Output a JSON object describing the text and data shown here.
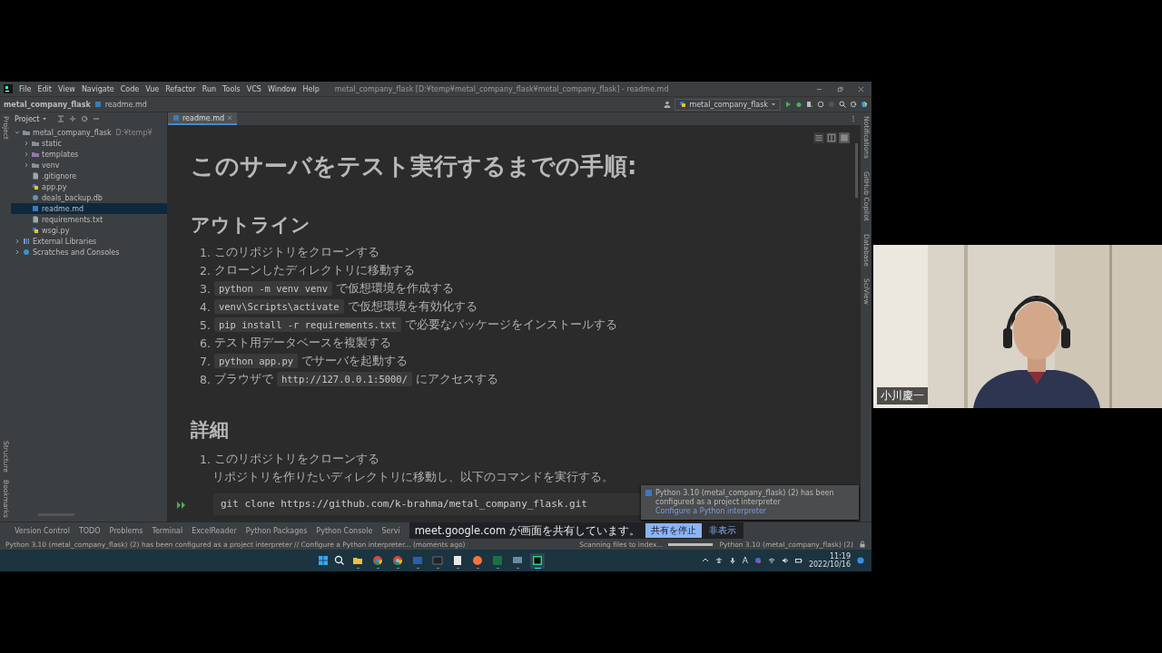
{
  "window": {
    "title": "metal_company_flask [D:¥temp¥metal_company_flask¥metal_company_flask] - readme.md"
  },
  "menu": [
    "File",
    "Edit",
    "View",
    "Navigate",
    "Code",
    "Vue",
    "Refactor",
    "Run",
    "Tools",
    "VCS",
    "Window",
    "Help"
  ],
  "breadcrumb": [
    "metal_company_flask",
    "readme.md"
  ],
  "run_config": "metal_company_flask",
  "left_stripe": [
    "Project",
    "Structure",
    "Bookmarks"
  ],
  "right_stripe": [
    "Notifications",
    "GitHub Copilot",
    "Database",
    "SciView"
  ],
  "project_tool": {
    "label": "Project"
  },
  "editor_tabs": [
    {
      "label": "readme.md",
      "selected": true
    }
  ],
  "tree": [
    {
      "label": "metal_company_flask",
      "hint": "D:¥temp¥",
      "kind": "folder",
      "expanded": true,
      "selected": false,
      "children": [
        {
          "label": "static",
          "kind": "folder",
          "expanded": false,
          "selected": false
        },
        {
          "label": "templates",
          "kind": "template-folder",
          "expanded": false,
          "selected": false
        },
        {
          "label": "venv",
          "kind": "folder",
          "expanded": false,
          "selected": false
        },
        {
          "label": ".gitignore",
          "kind": "file",
          "selected": false
        },
        {
          "label": "app.py",
          "kind": "python",
          "selected": false
        },
        {
          "label": "deals_backup.db",
          "kind": "db",
          "selected": false
        },
        {
          "label": "readme.md",
          "kind": "markdown",
          "selected": true
        },
        {
          "label": "requirements.txt",
          "kind": "file",
          "selected": false
        },
        {
          "label": "wsgi.py",
          "kind": "python",
          "selected": false
        }
      ]
    },
    {
      "label": "External Libraries",
      "kind": "libs",
      "expanded": false,
      "selected": false
    },
    {
      "label": "Scratches and Consoles",
      "kind": "scratches",
      "expanded": false,
      "selected": false
    }
  ],
  "preview": {
    "title": "このサーバをテスト実行するまでの手順:",
    "outline_heading": "アウトライン",
    "outline": [
      {
        "number": "1.",
        "parts": [
          {
            "kind": "text",
            "text": "このリポジトリをクローンする"
          }
        ]
      },
      {
        "number": "2.",
        "parts": [
          {
            "kind": "text",
            "text": "クローンしたディレクトリに移動する"
          }
        ]
      },
      {
        "number": "3.",
        "parts": [
          {
            "kind": "code",
            "text": "python -m venv venv"
          },
          {
            "kind": "text",
            "text": "で仮想環境を作成する"
          }
        ]
      },
      {
        "number": "4.",
        "parts": [
          {
            "kind": "code",
            "text": "venv\\Scripts\\activate"
          },
          {
            "kind": "text",
            "text": "で仮想環境を有効化する"
          }
        ]
      },
      {
        "number": "5.",
        "parts": [
          {
            "kind": "code",
            "text": "pip install -r requirements.txt"
          },
          {
            "kind": "text",
            "text": "で必要なパッケージをインストールする"
          }
        ]
      },
      {
        "number": "6.",
        "parts": [
          {
            "kind": "text",
            "text": "テスト用データベースを複製する"
          }
        ]
      },
      {
        "number": "7.",
        "parts": [
          {
            "kind": "code",
            "text": "python app.py"
          },
          {
            "kind": "text",
            "text": "でサーバを起動する"
          }
        ]
      },
      {
        "number": "8.",
        "parts": [
          {
            "kind": "text",
            "text": "ブラウザで"
          },
          {
            "kind": "code",
            "text": "http://127.0.0.1:5000/"
          },
          {
            "kind": "text",
            "text": "にアクセスする"
          }
        ]
      }
    ],
    "detail_heading": "詳細",
    "detail_item": {
      "number": "1.",
      "text": "このリポジトリをクローンする"
    },
    "detail_paragraph": "リポジトリを作りたいディレクトリに移動し、以下のコマンドを実行する。",
    "code_block": "git clone https://github.com/k-brahma/metal_company_flask.git"
  },
  "notification": {
    "message": "Python 3.10 (metal_company_flask) (2) has been configured as a project interpreter",
    "link": "Configure a Python interpreter"
  },
  "tool_windows": [
    "Version Control",
    "TODO",
    "Problems",
    "Terminal",
    "ExcelReader",
    "Python Packages",
    "Python Console",
    "Servi"
  ],
  "share_bar": {
    "message": "meet.google.com が画面を共有しています。",
    "stop": "共有を停止",
    "hide": "非表示"
  },
  "status": {
    "message": "Python 3.10 (metal_company_flask) (2) has been configured as a project interpreter // Configure a Python interpreter... (moments ago)",
    "task": "Scanning files to index...",
    "level": 0.97,
    "interpreter": "Python 3.10 (metal_company_flask) (2)"
  },
  "taskbar": {
    "apps": [
      {
        "kind": "folder",
        "selected": false
      },
      {
        "kind": "chrome",
        "selected": false
      },
      {
        "kind": "chrome-blue",
        "selected": false
      },
      {
        "kind": "powershell",
        "selected": false
      },
      {
        "kind": "terminal",
        "selected": false
      },
      {
        "kind": "notepad",
        "selected": false
      },
      {
        "kind": "firefox",
        "selected": false
      },
      {
        "kind": "excel",
        "selected": false
      },
      {
        "kind": "remote",
        "selected": false
      },
      {
        "kind": "pycharm",
        "selected": true
      }
    ],
    "ime": "A",
    "time": "11:19",
    "date": "2022/10/16"
  },
  "participant": {
    "name": "小川慶一"
  }
}
